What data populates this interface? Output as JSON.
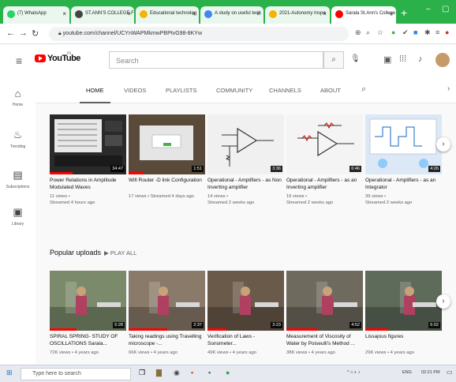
{
  "browser": {
    "tabs": [
      {
        "label": "(7) WhatsApp",
        "color": "#25d366"
      },
      {
        "label": "ST.ANN'S COLLEGE FO",
        "color": "#444444"
      },
      {
        "label": "Educational technolog",
        "color": "#f4b400"
      },
      {
        "label": "A study on useful tech",
        "color": "#4285f4"
      },
      {
        "label": "2021-Autonomy Inspe",
        "color": "#f4b400"
      },
      {
        "label": "Sarala St.Ann's College",
        "color": "#ff0000"
      }
    ],
    "url": "youtube.com/channel/UCYnWAPMkmwPBPtvG98-8KYw"
  },
  "youtube": {
    "logo_text": "YouTube",
    "country": "IN",
    "search_placeholder": "Search"
  },
  "sidebar": [
    {
      "icon": "home-icon",
      "glyph": "⌂",
      "label": "Home"
    },
    {
      "icon": "trending-icon",
      "glyph": "♨",
      "label": "Trending"
    },
    {
      "icon": "subscriptions-icon",
      "glyph": "▤",
      "label": "Subscriptions"
    },
    {
      "icon": "library-icon",
      "glyph": "▣",
      "label": "Library"
    }
  ],
  "channel_tabs": [
    "HOME",
    "VIDEOS",
    "PLAYLISTS",
    "COMMUNITY",
    "CHANNELS",
    "ABOUT"
  ],
  "recent_videos": [
    {
      "title": "Power Relations in Amplitude Modulated Waves",
      "meta1": "11 views •",
      "meta2": "Streamed 4 hours ago",
      "duration": "34:47",
      "bg": "#2a2a2a",
      "progress": 0.3
    },
    {
      "title": "Wifi Router -D link Configuration",
      "meta1": "17 views • Streamed 4 days ago",
      "meta2": "",
      "duration": "1:51",
      "bg": "#5a4a3a",
      "progress": 0.2
    },
    {
      "title": "Operational - Amplifiers - as Non Inverting amplifier",
      "meta1": "14 views •",
      "meta2": "Streamed 2 weeks ago",
      "duration": "3:36",
      "bg": "#f0f0f0",
      "progress": 0
    },
    {
      "title": "Operational - Amplifiers - as an Inverting amplifier",
      "meta1": "16 views •",
      "meta2": "Streamed 2 weeks ago",
      "duration": "6:46",
      "bg": "#f4f4f4",
      "progress": 0
    },
    {
      "title": "Operational - Amplifiers - as an Integrator",
      "meta1": "39 views •",
      "meta2": "Streamed 2 weeks ago",
      "duration": "4:26",
      "bg": "#dde8f6",
      "progress": 0
    }
  ],
  "popular": {
    "title": "Popular uploads",
    "play_all": "PLAY ALL",
    "videos": [
      {
        "title": "SPIRAL SPRING- STUDY OF OSCILLATIONS Sarala...",
        "meta1": "72K views • 4 years ago",
        "duration": "5:28",
        "bg": "#7a8a6a",
        "progress": 0.35
      },
      {
        "title": "Taking readings using Travelling microscope -...",
        "meta1": "66K views • 4 years ago",
        "duration": "2:37",
        "bg": "#8a7a6a",
        "progress": 0.5
      },
      {
        "title": "Verification of Laws - Sonometer...",
        "meta1": "49K views • 4 years ago",
        "duration": "3:23",
        "bg": "#6a5a4a",
        "progress": 0.25
      },
      {
        "title": "Measurement of Viscosity of Water by Poiseulli's Method ...",
        "meta1": "38K views • 4 years ago",
        "duration": "4:52",
        "bg": "#6f6a5e",
        "progress": 0.4
      },
      {
        "title": "Lissajous figures",
        "meta1": "29K views • 4 years ago",
        "duration": "6:02",
        "bg": "#5e6a5a",
        "progress": 0.3
      }
    ]
  },
  "taskbar": {
    "search_placeholder": "Type here to search",
    "lang": "ENG",
    "time": "02:21 PM"
  }
}
